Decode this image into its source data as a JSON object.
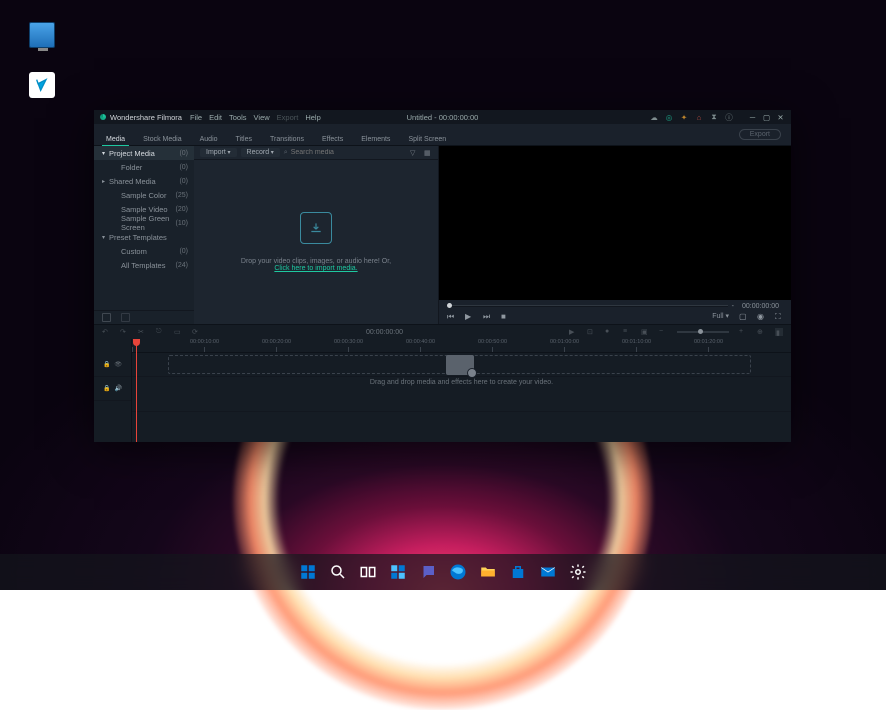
{
  "desktop": {
    "icons": {
      "this_pc": "This PC",
      "recycle_bin": "Recycle Bin"
    }
  },
  "app": {
    "name": "Wondershare Filmora",
    "menus": [
      "File",
      "Edit",
      "Tools",
      "View",
      "Export",
      "Help"
    ],
    "title": "Untitled - 00:00:00:00",
    "main_tabs": [
      "Media",
      "Stock Media",
      "Audio",
      "Titles",
      "Transitions",
      "Effects",
      "Elements",
      "Split Screen"
    ],
    "export_label": "Export",
    "sidebar": {
      "items": [
        {
          "label": "Project Media",
          "count": "(0)",
          "arrow": "▾",
          "active": true,
          "indent": false
        },
        {
          "label": "Folder",
          "count": "(0)",
          "arrow": "",
          "active": false,
          "indent": true
        },
        {
          "label": "Shared Media",
          "count": "(0)",
          "arrow": "▸",
          "active": false,
          "indent": false
        },
        {
          "label": "Sample Color",
          "count": "(25)",
          "arrow": "",
          "active": false,
          "indent": true
        },
        {
          "label": "Sample Video",
          "count": "(20)",
          "arrow": "",
          "active": false,
          "indent": true
        },
        {
          "label": "Sample Green Screen",
          "count": "(10)",
          "arrow": "",
          "active": false,
          "indent": true
        },
        {
          "label": "Preset Templates",
          "count": "",
          "arrow": "▾",
          "active": false,
          "indent": false
        },
        {
          "label": "Custom",
          "count": "(0)",
          "arrow": "",
          "active": false,
          "indent": true
        },
        {
          "label": "All Templates",
          "count": "(24)",
          "arrow": "",
          "active": false,
          "indent": true
        }
      ]
    },
    "media": {
      "import_label": "Import",
      "record_label": "Record",
      "search_placeholder": "Search media",
      "drop_hint": "Drop your video clips, images, or audio here! Or,",
      "drop_link": "Click here to import media."
    },
    "preview": {
      "time_left": "-",
      "time_right": "00:00:00:00",
      "quality": "Full"
    },
    "timeline": {
      "time_center": "00:00:00:00",
      "ruler_labels": [
        "",
        "00:00:10:00",
        "00:00:20:00",
        "00:00:30:00",
        "00:00:40:00",
        "00:00:50:00",
        "00:01:00:00",
        "00:01:10:00",
        "00:01:20:00"
      ],
      "hint": "Drag and drop media and effects here to create your video."
    }
  },
  "taskbar": {
    "items": [
      "start",
      "search",
      "task-view",
      "widgets",
      "chat",
      "edge",
      "file-explorer",
      "store",
      "mail",
      "settings"
    ]
  }
}
